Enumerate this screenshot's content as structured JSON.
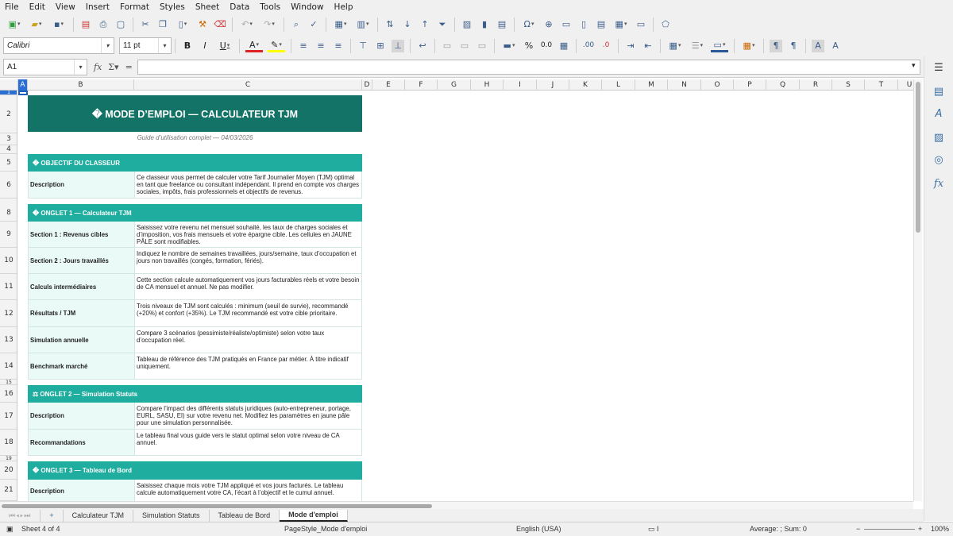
{
  "menu": [
    "File",
    "Edit",
    "View",
    "Insert",
    "Format",
    "Styles",
    "Sheet",
    "Data",
    "Tools",
    "Window",
    "Help"
  ],
  "font": {
    "name": "Calibri",
    "size": "11 pt"
  },
  "namebox": "A1",
  "columns": [
    "A",
    "B",
    "C",
    "D",
    "E",
    "F",
    "G",
    "H",
    "I",
    "J",
    "K",
    "L",
    "M",
    "N",
    "O",
    "P",
    "Q",
    "R",
    "S",
    "T",
    "U"
  ],
  "rows": [
    "1",
    "2",
    "3",
    "4",
    "5",
    "6",
    "8",
    "9",
    "10",
    "11",
    "12",
    "13",
    "14",
    "15",
    "16",
    "17",
    "18",
    "19",
    "20",
    "21"
  ],
  "sheet": {
    "title": "� MODE D’EMPLOI — CALCULATEUR TJM",
    "subtitle": "Guide d’utilisation complet — 04/03/2026",
    "sec1": "� OBJECTIF DU CLASSEUR",
    "r6": {
      "label": "Description",
      "text": "Ce classeur vous permet de calculer votre Tarif Journalier Moyen (TJM) optimal en tant que freelance ou consultant indépendant. Il prend en compte vos charges sociales, impôts, frais professionnels et objectifs de revenus."
    },
    "sec2": "� ONGLET 1 — Calculateur TJM",
    "r9": {
      "label": "Section 1 : Revenus cibles",
      "text": "Saisissez votre revenu net mensuel souhaité, les taux de charges sociales et d’imposition, vos frais mensuels et votre épargne cible. Les cellules en JAUNE PÂLE sont modifiables."
    },
    "r10": {
      "label": "Section 2 : Jours travaillés",
      "text": "Indiquez le nombre de semaines travaillées, jours/semaine, taux d’occupation et jours non travaillés (congés, formation, fériés)."
    },
    "r11": {
      "label": "Calculs intermédiaires",
      "text": "Cette section calcule automatiquement vos jours facturables réels et votre besoin de CA mensuel et annuel. Ne pas modifier."
    },
    "r12": {
      "label": "Résultats / TJM",
      "text": "Trois niveaux de TJM sont calculés : minimum (seuil de survie), recommandé (+20%) et confort (+35%). Le TJM recommandé est votre cible prioritaire."
    },
    "r13": {
      "label": "Simulation annuelle",
      "text": "Compare 3 scénarios (pessimiste/réaliste/optimiste) selon votre taux d’occupation réel."
    },
    "r14": {
      "label": "Benchmark marché",
      "text": "Tableau de référence des TJM pratiqués en France par métier. À titre indicatif uniquement."
    },
    "sec3": "⚖ ONGLET 2 — Simulation Statuts",
    "r17": {
      "label": "Description",
      "text": "Compare l’impact des différents statuts juridiques (auto-entrepreneur, portage, EURL, SASU, EI) sur votre revenu net. Modifiez les paramètres en jaune pâle pour une simulation personnalisée."
    },
    "r18": {
      "label": "Recommandations",
      "text": "Le tableau final vous guide vers le statut optimal selon votre niveau de CA annuel."
    },
    "sec4": "� ONGLET 3 — Tableau de Bord",
    "r21": {
      "label": "Description",
      "text": "Saisissez chaque mois votre TJM appliqué et vos jours facturés. Le tableau calcule automatiquement votre CA, l’écart à l’objectif et le cumul annuel."
    }
  },
  "tabs": [
    "Calculateur TJM",
    "Simulation Statuts",
    "Tableau de Bord",
    "Mode d'emploi"
  ],
  "status": {
    "sheet": "Sheet 4 of 4",
    "pagestyle": "PageStyle_Mode d'emploi",
    "lang": "English (USA)",
    "sum": "Average: ; Sum: 0",
    "zoom": "100%"
  },
  "colors": {
    "banner": "#137366",
    "section": "#1fad9f",
    "label_bg": "#eafaf7"
  }
}
